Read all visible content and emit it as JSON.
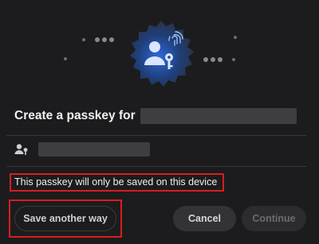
{
  "dialog": {
    "title": "Create a passkey for",
    "notice": "This passkey will only be saved on this device"
  },
  "icons": {
    "hero": "passkey-fingerprint-badge-icon",
    "account": "person-key-icon"
  },
  "buttons": {
    "save_another_way": "Save another way",
    "cancel": "Cancel",
    "continue": "Continue"
  },
  "colors": {
    "background": "#1c1c1e",
    "badge_blue": "#2f6ad9",
    "highlight_red": "#d71e1e"
  }
}
